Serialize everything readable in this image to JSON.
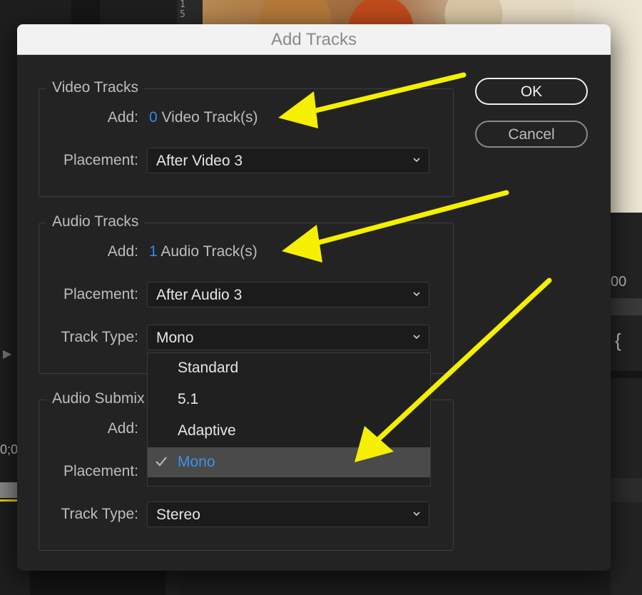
{
  "background": {
    "ruler_numbers": [
      "1",
      "5"
    ],
    "right_text": "00",
    "right_brace": "{",
    "left_text": "0;0",
    "left_play": "▶"
  },
  "dialog": {
    "title": "Add Tracks",
    "ok_label": "OK",
    "cancel_label": "Cancel",
    "video": {
      "legend": "Video Tracks",
      "add_label": "Add:",
      "add_count": "0",
      "add_suffix": "Video Track(s)",
      "placement_label": "Placement:",
      "placement_value": "After Video 3"
    },
    "audio": {
      "legend": "Audio Tracks",
      "add_label": "Add:",
      "add_count": "1",
      "add_suffix": "Audio Track(s)",
      "placement_label": "Placement:",
      "placement_value": "After Audio 3",
      "track_type_label": "Track Type:",
      "track_type_value": "Mono"
    },
    "submix": {
      "legend": "Audio Submix",
      "add_label": "Add:",
      "placement_label": "Placement:",
      "track_type_label": "Track Type:",
      "track_type_value": "Stereo"
    },
    "dropdown": {
      "options": [
        "Standard",
        "5.1",
        "Adaptive",
        "Mono"
      ],
      "selected": "Mono"
    }
  },
  "colors": {
    "accent_blue": "#2d8ceb",
    "arrow_yellow": "#f5f000",
    "dialog_bg": "#232323",
    "titlebar_bg": "#f2f2f2"
  },
  "icons": {
    "dropdown_chevron": "chevron-down-icon",
    "selected_check": "checkmark-icon",
    "annotation_arrow": "arrow-icon"
  }
}
